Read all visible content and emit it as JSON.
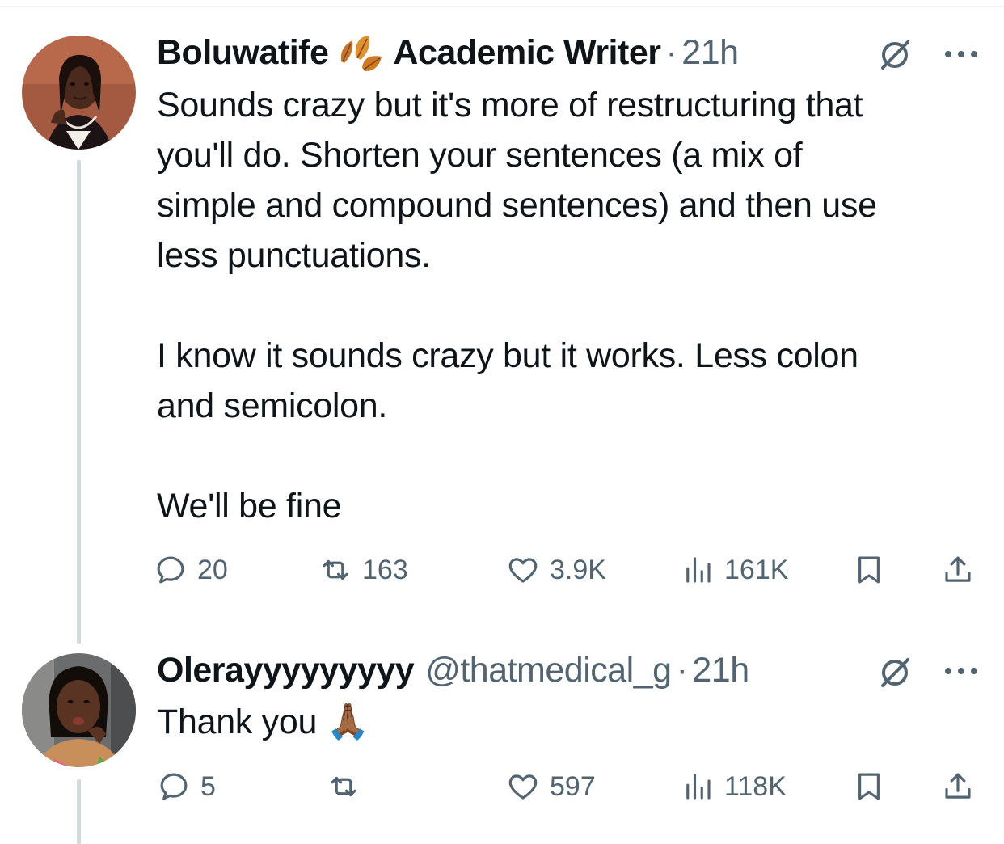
{
  "tweets": [
    {
      "author": "Boluwatife",
      "title": "Academic Writer",
      "separator": "·",
      "time": "21h",
      "body": "Sounds crazy but it's more of restructuring that\nyou'll do. Shorten your sentences (a mix of\nsimple and compound sentences) and then use\nless punctuations.\n\nI know it sounds crazy but it works. Less colon\nand semicolon.\n\nWe'll be fine",
      "stats": {
        "replies": "20",
        "reposts": "163",
        "likes": "3.9K",
        "views": "161K"
      }
    },
    {
      "author": "Olerayyyyyyyyy",
      "handle": "@thatmedical_g",
      "separator": "·",
      "time": "21h",
      "body": "Thank you 🙏🏾",
      "stats": {
        "replies": "5",
        "reposts": "",
        "likes": "597",
        "views": "118K"
      }
    }
  ],
  "icons": {
    "reply": "reply-icon",
    "repost": "repost-icon",
    "like": "heart-icon",
    "views": "views-icon",
    "bookmark": "bookmark-icon",
    "share": "share-icon",
    "grok": "grok-icon",
    "more": "more-icon",
    "emoji": "leaves-emoji"
  },
  "colors": {
    "text": "#0f1419",
    "secondary": "#536471",
    "thread_line": "#cfd9de",
    "divider": "#eff3f4"
  }
}
